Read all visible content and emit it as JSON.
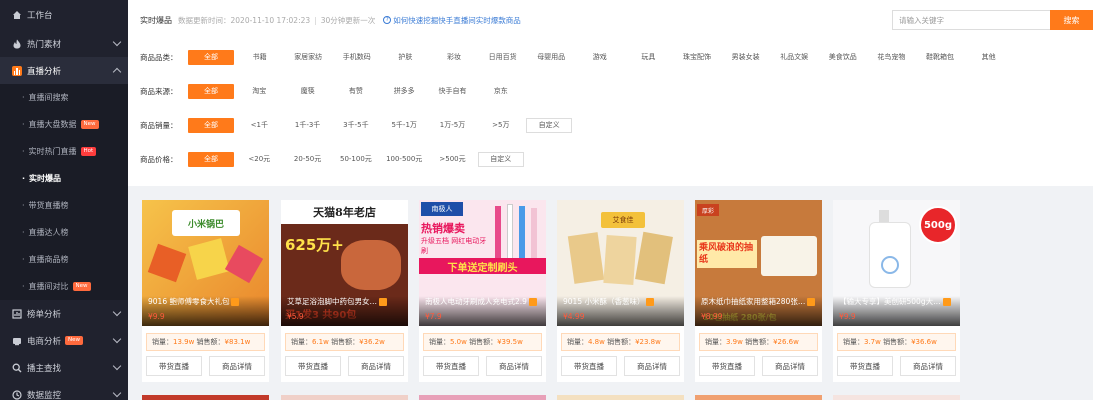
{
  "sidebar": {
    "items": [
      {
        "label": "工作台",
        "icon": "home-icon"
      },
      {
        "label": "热门素材",
        "icon": "flame-icon"
      },
      {
        "label": "直播分析",
        "icon": "live-chart-icon"
      }
    ],
    "subitems": [
      {
        "label": "直播间搜索",
        "badge": ""
      },
      {
        "label": "直播大盘数据",
        "badge": "New"
      },
      {
        "label": "实时热门直播",
        "badge": "Hot"
      },
      {
        "label": "实时爆品",
        "badge": ""
      },
      {
        "label": "带货直播榜",
        "badge": ""
      },
      {
        "label": "直播达人榜",
        "badge": ""
      },
      {
        "label": "直播商品榜",
        "badge": ""
      },
      {
        "label": "直播间对比",
        "badge": "New"
      }
    ],
    "bottom": [
      {
        "label": "榜单分析",
        "icon": "ranking-icon",
        "badge": ""
      },
      {
        "label": "电商分析",
        "icon": "cart-icon",
        "badge": "New"
      },
      {
        "label": "播主查找",
        "icon": "search-icon",
        "badge": ""
      },
      {
        "label": "数据监控",
        "icon": "monitor-icon",
        "badge": ""
      }
    ]
  },
  "topbar": {
    "title": "实时爆品",
    "time": "数据更新时间：2020-11-10 17:02:23",
    "sep": "|",
    "update": "30分钟更新一次",
    "help": "如何快速挖掘快手直播间实时爆款商品",
    "search_placeholder": "请输入关键字",
    "search_button": "搜索"
  },
  "filters": {
    "category": {
      "label": "商品品类：",
      "options": [
        "全部",
        "书籍",
        "家居家纺",
        "手机数码",
        "护肤",
        "彩妆",
        "日用百货",
        "母婴用品",
        "游戏",
        "玩具",
        "珠宝配饰",
        "男装女装",
        "礼品文娱",
        "美食饮品",
        "花鸟宠物",
        "鞋靴箱包",
        "其他"
      ]
    },
    "source": {
      "label": "商品来源：",
      "options": [
        "全部",
        "淘宝",
        "魔筷",
        "有赞",
        "拼多多",
        "快手自有",
        "京东"
      ]
    },
    "sales": {
      "label": "商品销量：",
      "options": [
        "全部",
        "<1千",
        "1千-3千",
        "3千-5千",
        "5千-1万",
        "1万-5万",
        ">5万",
        "自定义"
      ]
    },
    "price": {
      "label": "商品价格：",
      "options": [
        "全部",
        "<20元",
        "20-50元",
        "50-100元",
        "100-500元",
        ">500元",
        "自定义"
      ]
    }
  },
  "cards": [
    {
      "title": "9016 鲍师傅零食大礼包",
      "price": "¥9.9",
      "sales_label": "销量：",
      "sales": "13.9w",
      "amount_label": "销售额：",
      "amount": "¥83.1w",
      "btn1": "带货直播",
      "btn2": "商品详情",
      "img_text": "小米锅巴",
      "img_color": "#f3a33b"
    },
    {
      "title": "艾草足浴泡脚中药包男女…",
      "price": "¥5.9",
      "sales_label": "销量：",
      "sales": "6.1w",
      "amount_label": "销售额：",
      "amount": "¥36.2w",
      "btn1": "带货直播",
      "btn2": "商品详情",
      "img_text": "天猫8年老店",
      "img_text2": "625万+",
      "img_text3": "买1发3 共90包",
      "img_color": "#b8432a"
    },
    {
      "title": "南极人电动牙刷成人充电式2.9",
      "price": "¥7.9",
      "sales_label": "销量：",
      "sales": "5.0w",
      "amount_label": "销售额：",
      "amount": "¥39.5w",
      "btn1": "带货直播",
      "btn2": "商品详情",
      "img_text": "热销爆卖",
      "img_text2": "升级五档 网红电动牙刷",
      "img_text3": "下单送定制刷头",
      "img_brand": "南极人",
      "img_color": "#e9557a"
    },
    {
      "title": "9015 小米酥（香葱味）",
      "price": "¥4.99",
      "sales_label": "销量：",
      "sales": "4.8w",
      "amount_label": "销售额：",
      "amount": "¥23.8w",
      "btn1": "带货直播",
      "btn2": "商品详情",
      "img_text": "艾食佳",
      "img_color": "#f5efe4"
    },
    {
      "title": "原木纸巾抽纸家用整箱280张…",
      "price": "¥8.99",
      "sales_label": "销量：",
      "sales": "3.9w",
      "amount_label": "销售额：",
      "amount": "¥26.6w",
      "btn1": "带货直播",
      "btn2": "商品详情",
      "img_text": "乘风破浪的抽纸",
      "img_text2": "厚彩",
      "img_text3": "10包抽纸 280张/包",
      "img_color": "#d58a4a"
    },
    {
      "title": "【输大专享】美创研500g大…",
      "price": "¥9.9",
      "sales_label": "销量：",
      "sales": "3.7w",
      "amount_label": "销售额：",
      "amount": "¥36.6w",
      "btn1": "带货直播",
      "btn2": "商品详情",
      "img_text": "500g",
      "img_color": "#ffffff"
    }
  ]
}
